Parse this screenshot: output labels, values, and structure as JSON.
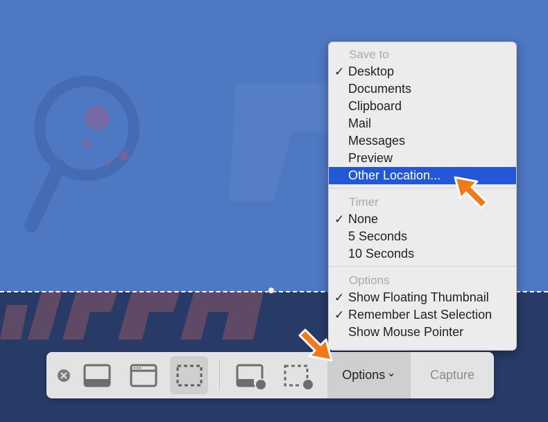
{
  "menu": {
    "sections": [
      {
        "header": "Save to",
        "items": [
          {
            "label": "Desktop",
            "checked": true
          },
          {
            "label": "Documents",
            "checked": false
          },
          {
            "label": "Clipboard",
            "checked": false
          },
          {
            "label": "Mail",
            "checked": false
          },
          {
            "label": "Messages",
            "checked": false
          },
          {
            "label": "Preview",
            "checked": false
          },
          {
            "label": "Other Location...",
            "checked": false,
            "highlighted": true
          }
        ]
      },
      {
        "header": "Timer",
        "items": [
          {
            "label": "None",
            "checked": true
          },
          {
            "label": "5 Seconds",
            "checked": false
          },
          {
            "label": "10 Seconds",
            "checked": false
          }
        ]
      },
      {
        "header": "Options",
        "items": [
          {
            "label": "Show Floating Thumbnail",
            "checked": true
          },
          {
            "label": "Remember Last Selection",
            "checked": true
          },
          {
            "label": "Show Mouse Pointer",
            "checked": false
          }
        ]
      }
    ],
    "check_glyph": "✓"
  },
  "toolbar": {
    "close_icon": "close-circle-icon",
    "tools": [
      {
        "name": "capture-entire-screen",
        "icon": "screen-icon",
        "selected": false
      },
      {
        "name": "capture-selected-window",
        "icon": "window-icon",
        "selected": false
      },
      {
        "name": "capture-selected-portion",
        "icon": "dashed-rect-icon",
        "selected": true
      },
      {
        "name": "record-entire-screen",
        "icon": "screen-record-icon",
        "selected": false
      },
      {
        "name": "record-selected-portion",
        "icon": "dashed-rect-record-icon",
        "selected": false
      }
    ],
    "options_label": "Options",
    "options_chevron": "⌄",
    "capture_label": "Capture"
  },
  "colors": {
    "highlight": "#2357d8",
    "annotation_arrow": "#f07a1a",
    "background_top": "#4f78c2",
    "background_bottom": "#283a66"
  }
}
